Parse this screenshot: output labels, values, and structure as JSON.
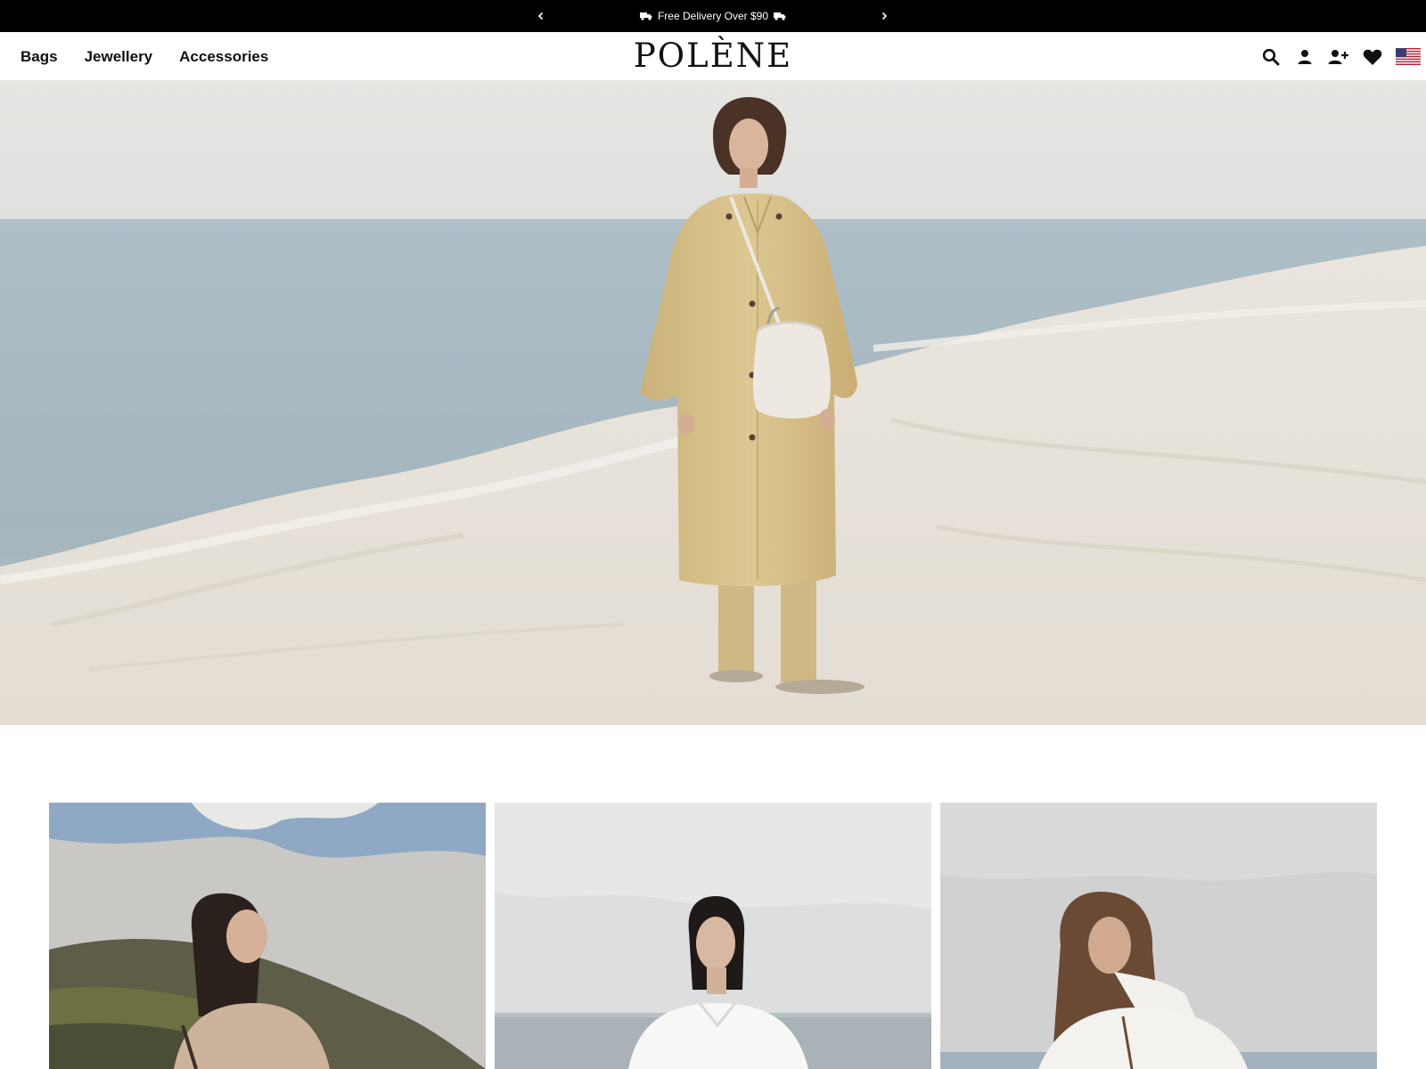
{
  "announcement": {
    "message": "Free Delivery Over $90",
    "prev_icon": "chevron-left-icon",
    "next_icon": "chevron-right-icon"
  },
  "header": {
    "logo": "POLÈNE",
    "nav": [
      {
        "label": "Bags"
      },
      {
        "label": "Jewellery"
      },
      {
        "label": "Accessories"
      }
    ],
    "icons": [
      "search-icon",
      "account-icon",
      "add-user-icon",
      "wishlist-heart-icon",
      "us-flag-icon"
    ]
  },
  "colors": {
    "announcement_bg": "#000000",
    "text": "#111111",
    "coat": "#dcc591",
    "sea": "#9fb4c0",
    "salt": "#ece7df"
  }
}
